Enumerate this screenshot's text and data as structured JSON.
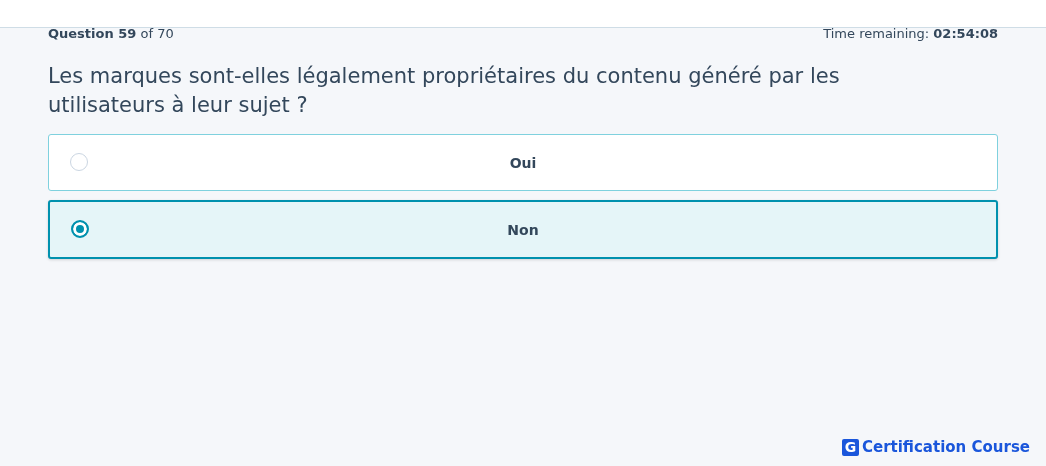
{
  "progress": {
    "question": "**Question 59** of 70",
    "timer": "Time remaining: **02:54:08**"
  },
  "question": "Les marques sont-elles légalement propriétaires du contenu généré par les utilisateurs à leur sujet ?",
  "options": [
    {
      "label": "Oui",
      "selected": false
    },
    {
      "label": "Non",
      "selected": true
    }
  ],
  "brand": {
    "logo_letter": "G",
    "name": "Certification Course"
  }
}
